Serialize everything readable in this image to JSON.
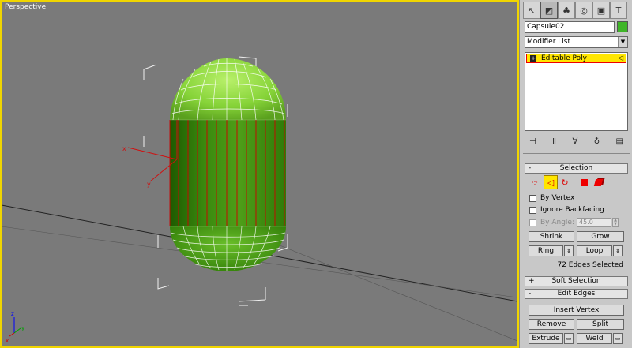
{
  "viewport": {
    "label": "Perspective"
  },
  "panel": {
    "tabs": [
      {
        "icon": "cursor-icon",
        "glyph": "↖"
      },
      {
        "icon": "modify-icon",
        "glyph": "◩"
      },
      {
        "icon": "hierarchy-icon",
        "glyph": "♣"
      },
      {
        "icon": "motion-icon",
        "glyph": "◎"
      },
      {
        "icon": "display-icon",
        "glyph": "▣"
      },
      {
        "icon": "utilities-icon",
        "glyph": "T"
      }
    ],
    "object_name": "Capsule02",
    "object_color": "#3fb528",
    "modifier_list_label": "Modifier List",
    "stack_item": "Editable Poly",
    "selection_rollout": {
      "title": "Selection",
      "sign": "-",
      "by_vertex": "By Vertex",
      "ignore_backfacing": "Ignore Backfacing",
      "by_angle": "By Angle:",
      "angle_value": "45.0",
      "shrink": "Shrink",
      "grow": "Grow",
      "ring": "Ring",
      "loop": "Loop",
      "status": "72 Edges Selected"
    },
    "soft_selection_rollout": {
      "title": "Soft Selection",
      "sign": "+"
    },
    "edit_edges_rollout": {
      "title": "Edit Edges",
      "sign": "-",
      "insert_vertex": "Insert Vertex",
      "remove": "Remove",
      "split": "Split",
      "extrude": "Extrude",
      "weld": "Weld"
    }
  }
}
